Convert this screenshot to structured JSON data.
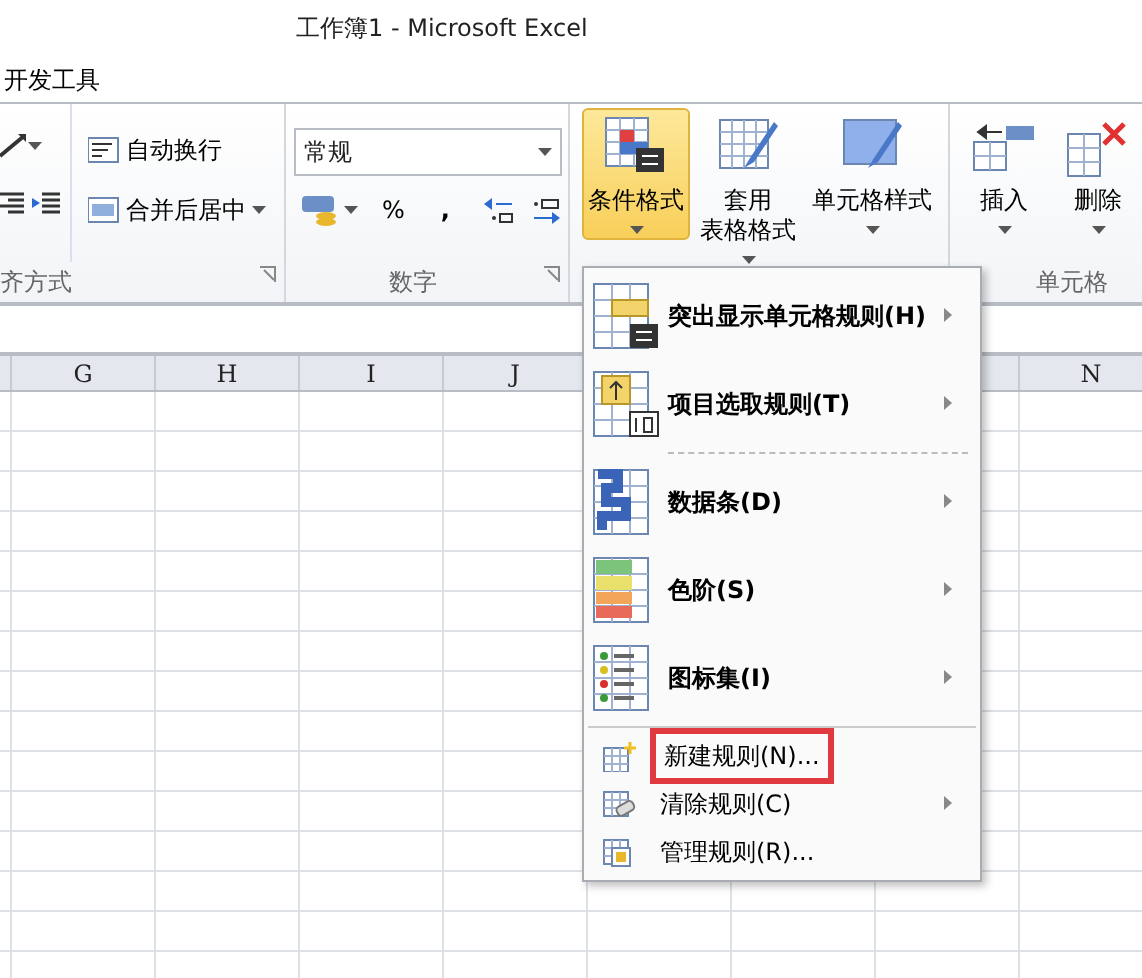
{
  "window": {
    "title": "工作簿1  -  Microsoft Excel"
  },
  "tabs": [
    {
      "label": "开发工具"
    }
  ],
  "ribbon": {
    "alignment": {
      "wrap": "自动换行",
      "merge": "合并后居中",
      "label": "齐方式"
    },
    "number": {
      "format": "常规",
      "percent": "%",
      "comma": ",",
      "label": "数字"
    },
    "styles": [
      {
        "lines": [
          "条件格式"
        ],
        "selected": true
      },
      {
        "lines": [
          "套用",
          "表格格式"
        ],
        "selected": false
      },
      {
        "lines": [
          "单元格样式"
        ],
        "selected": false
      }
    ],
    "cells": {
      "buttons": [
        {
          "label": "插入"
        },
        {
          "label": "删除"
        }
      ],
      "label": "单元格"
    }
  },
  "sheet": {
    "columns_left": [
      "G",
      "H",
      "I",
      "J"
    ],
    "columns_right": [
      "N"
    ]
  },
  "menu": [
    {
      "kind": "large",
      "label": "突出显示单元格规则(H)",
      "submenu": true
    },
    {
      "kind": "large",
      "label": "项目选取规则(T)",
      "submenu": true
    },
    {
      "kind": "dashed-separator"
    },
    {
      "kind": "large",
      "label": "数据条(D)",
      "submenu": true
    },
    {
      "kind": "large",
      "label": "色阶(S)",
      "submenu": true
    },
    {
      "kind": "large",
      "label": "图标集(I)",
      "submenu": true
    },
    {
      "kind": "separator"
    },
    {
      "kind": "small",
      "label": "新建规则(N)...",
      "submenu": false,
      "highlighted": true
    },
    {
      "kind": "small",
      "label": "清除规则(C)",
      "submenu": true,
      "highlighted": false
    },
    {
      "kind": "small",
      "label": "管理规则(R)...",
      "submenu": false,
      "highlighted": false
    }
  ]
}
